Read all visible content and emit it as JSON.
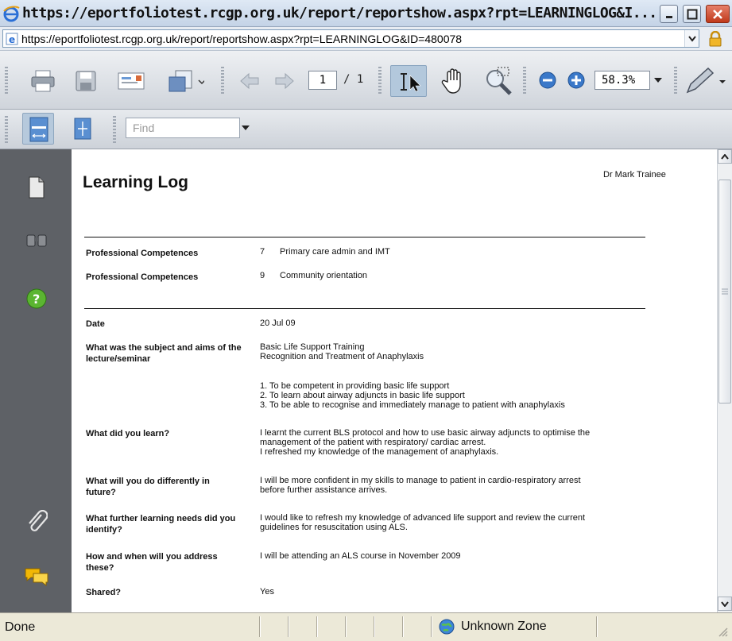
{
  "window": {
    "title": "https://eportfoliotest.rcgp.org.uk/report/reportshow.aspx?rpt=LEARNINGLOG&I...",
    "minimize": "–",
    "maximize": "□",
    "close": "✕"
  },
  "address": {
    "url": "https://eportfoliotest.rcgp.org.uk/report/reportshow.aspx?rpt=LEARNINGLOG&ID=480078"
  },
  "toolbar": {
    "page_current": "1",
    "page_total": "/ 1",
    "zoom": "58.3%"
  },
  "find": {
    "placeholder": "Find"
  },
  "document": {
    "title": "Learning Log",
    "author": "Dr Mark Trainee",
    "competences": [
      {
        "label": "Professional Competences",
        "number": "7",
        "value": "Primary care admin and IMT"
      },
      {
        "label": "Professional Competences",
        "number": "9",
        "value": "Community orientation"
      }
    ],
    "fields": [
      {
        "label": "Date",
        "value": "20 Jul 09"
      },
      {
        "label": "What was the subject and aims of the lecture/seminar",
        "value": "Basic Life Support Training\nRecognition and Treatment of Anaphylaxis"
      },
      {
        "label": "",
        "value": "1. To be competent in providing basic life support\n2. To learn about airway adjuncts in basic life support\n3. To be able to recognise and immediately manage to patient with anaphylaxis"
      },
      {
        "label": "What did you learn?",
        "value": "I learnt the current BLS protocol and how to use basic airway adjuncts to optimise the\nmanagement of the patient with respiratory/ cardiac arrest.\nI refreshed my knowledge of the management of anaphylaxis."
      },
      {
        "label": "What will you do differently in future?",
        "value": "I will be more confident in my skills to manage to patient in cardio-respiratory arrest\nbefore further assistance arrives."
      },
      {
        "label": "What further learning needs did you identify?",
        "value": "I would like to refresh my knowledge of advanced life support and review the current\nguidelines for resuscitation using ALS."
      },
      {
        "label": "How and when will you address these?",
        "value": "I will be attending an ALS course in November 2009"
      },
      {
        "label": "Shared?",
        "value": "Yes"
      }
    ]
  },
  "status": {
    "text": "Done",
    "zone": "Unknown Zone"
  },
  "colors": {
    "sidebar": "#5e6166",
    "help_icon": "#5bb531",
    "comment_icon": "#f2b705"
  }
}
